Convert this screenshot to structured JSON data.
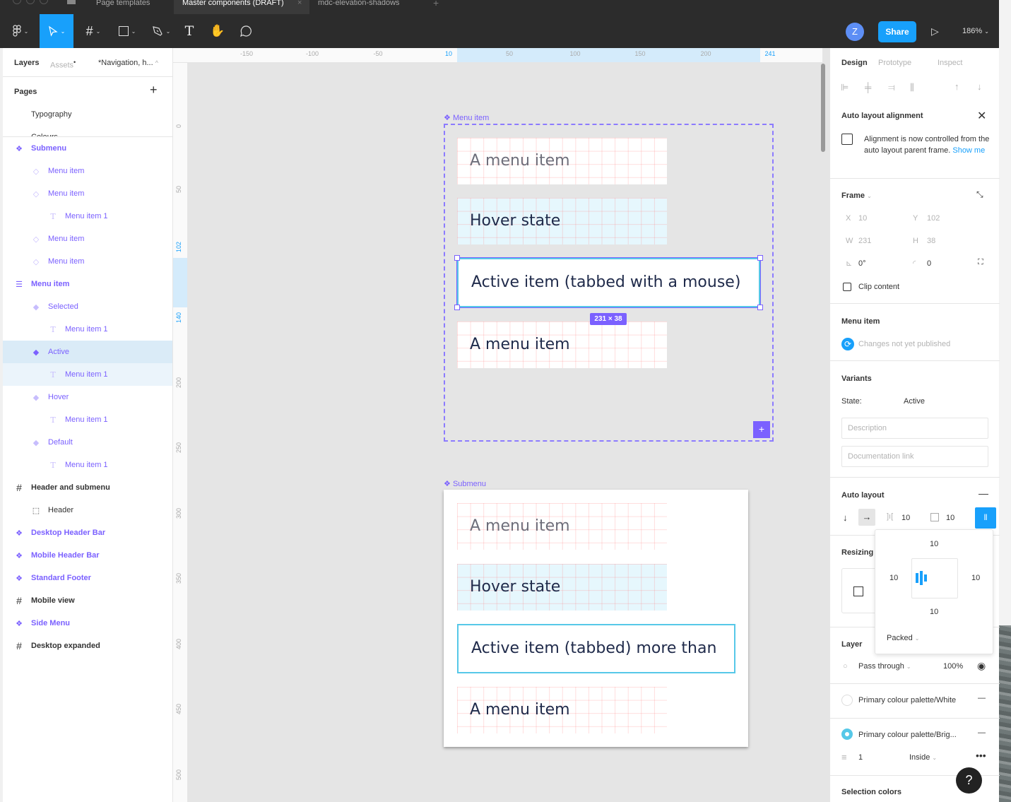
{
  "tabs": [
    {
      "label": "Page templates",
      "active": false
    },
    {
      "label": "Master components (DRAFT)",
      "active": true
    },
    {
      "label": "mdc-elevation-shadows",
      "active": false
    }
  ],
  "toolbar": {
    "tools": [
      "figma-menu",
      "move",
      "frame",
      "shape",
      "pen",
      "text",
      "hand",
      "comment"
    ],
    "avatar_initial": "Z",
    "share_label": "Share",
    "zoom_level": "186%"
  },
  "left_panel": {
    "tabs": {
      "layers": "Layers",
      "assets": "Assets",
      "page_selector": "*Navigation, h..."
    },
    "pages_title": "Pages",
    "pages": [
      "Typography",
      "Colours"
    ],
    "layers": [
      {
        "label": "Submenu",
        "icon": "component-icon",
        "depth": 0,
        "style": "component"
      },
      {
        "label": "Menu item",
        "icon": "instance-icon",
        "depth": 1,
        "style": "instance"
      },
      {
        "label": "Menu item",
        "icon": "instance-icon",
        "depth": 1,
        "style": "instance"
      },
      {
        "label": "Menu item 1",
        "icon": "text-icon",
        "depth": 2,
        "style": "instance"
      },
      {
        "label": "Menu item",
        "icon": "instance-icon",
        "depth": 1,
        "style": "instance"
      },
      {
        "label": "Menu item",
        "icon": "instance-icon",
        "depth": 1,
        "style": "instance"
      },
      {
        "label": "Menu item",
        "icon": "variant-set-icon",
        "depth": 0,
        "style": "component"
      },
      {
        "label": "Selected",
        "icon": "variant-icon",
        "depth": 1,
        "style": "instance"
      },
      {
        "label": "Menu item 1",
        "icon": "text-icon",
        "depth": 2,
        "style": "instance"
      },
      {
        "label": "Active",
        "icon": "variant-icon",
        "depth": 1,
        "style": "instance",
        "selected": true
      },
      {
        "label": "Menu item 1",
        "icon": "text-icon",
        "depth": 2,
        "style": "instance",
        "child_selected": true
      },
      {
        "label": "Hover",
        "icon": "variant-icon",
        "depth": 1,
        "style": "instance"
      },
      {
        "label": "Menu item 1",
        "icon": "text-icon",
        "depth": 2,
        "style": "instance"
      },
      {
        "label": "Default",
        "icon": "variant-icon",
        "depth": 1,
        "style": "instance"
      },
      {
        "label": "Menu item 1",
        "icon": "text-icon",
        "depth": 2,
        "style": "instance"
      },
      {
        "label": "Header and submenu",
        "icon": "frame-icon",
        "depth": 0,
        "style": "frame"
      },
      {
        "label": "Header",
        "icon": "group-icon",
        "depth": 1,
        "style": "plain"
      },
      {
        "label": "Desktop Header Bar",
        "icon": "component-icon",
        "depth": 0,
        "style": "component"
      },
      {
        "label": "Mobile Header Bar",
        "icon": "component-icon",
        "depth": 0,
        "style": "component"
      },
      {
        "label": "Standard Footer",
        "icon": "component-icon",
        "depth": 0,
        "style": "component"
      },
      {
        "label": "Mobile view",
        "icon": "frame-icon",
        "depth": 0,
        "style": "frame"
      },
      {
        "label": "Side Menu",
        "icon": "component-icon",
        "depth": 0,
        "style": "component"
      },
      {
        "label": "Desktop expanded",
        "icon": "frame-icon",
        "depth": 0,
        "style": "frame"
      }
    ]
  },
  "rulers": {
    "horizontal": [
      "-150",
      "-100",
      "-50",
      "10",
      "50",
      "100",
      "150",
      "200",
      "241"
    ],
    "vertical": [
      "0",
      "50",
      "102",
      "140",
      "200",
      "250",
      "300",
      "350",
      "400",
      "450",
      "500"
    ],
    "highlight_h": [
      "10",
      "241"
    ],
    "highlight_v": [
      "102",
      "140"
    ]
  },
  "canvas": {
    "frame1": {
      "label": "Menu item",
      "items": [
        {
          "text": "A menu item",
          "state": "default-grey"
        },
        {
          "text": "Hover state",
          "state": "hover"
        },
        {
          "text": "Active item (tabbed with a mouse)",
          "state": "active"
        },
        {
          "text": "A menu item",
          "state": "default"
        }
      ],
      "size_badge": "231 × 38"
    },
    "frame2": {
      "label": "Submenu",
      "items": [
        {
          "text": "A menu item",
          "state": "default-grey"
        },
        {
          "text": "Hover state",
          "state": "hover"
        },
        {
          "text": "Active item (tabbed) more than",
          "state": "active"
        },
        {
          "text": "A menu item",
          "state": "default"
        }
      ]
    },
    "colors": {
      "selection": "#7b61ff",
      "active_border": "#56c8e8",
      "hover_bg": "#e6f7fd",
      "text": "#1f2a4a"
    }
  },
  "right_panel": {
    "tabs": [
      "Design",
      "Prototype",
      "Inspect"
    ],
    "auto_layout_alignment": {
      "title": "Auto layout alignment",
      "message": "Alignment is now controlled from the auto layout parent frame.",
      "link": "Show me"
    },
    "frame": {
      "title": "Frame",
      "x": "10",
      "y": "102",
      "w": "231",
      "h": "38",
      "rotation": "0°",
      "radius": "0",
      "clip_content": "Clip content",
      "labels": {
        "x": "X",
        "y": "Y",
        "w": "W",
        "h": "H"
      }
    },
    "component": {
      "title": "Menu item",
      "status": "Changes not yet published"
    },
    "variants": {
      "title": "Variants",
      "property": "State:",
      "value": "Active",
      "description_placeholder": "Description",
      "doc_link_placeholder": "Documentation link"
    },
    "auto_layout": {
      "title": "Auto layout",
      "spacing": "10",
      "padding": "10"
    },
    "padding_popover": {
      "top": "10",
      "left": "10",
      "right": "10",
      "bottom": "10",
      "distribution": "Packed"
    },
    "resizing": {
      "title": "Resizing"
    },
    "layer": {
      "title": "Layer",
      "blend": "Pass through",
      "opacity": "100%"
    },
    "fills": [
      {
        "name": "Primary colour palette/White",
        "color": "#ffffff"
      },
      {
        "name": "Primary colour palette/Brig...",
        "color": "#56c8e8"
      }
    ],
    "stroke": {
      "weight": "1",
      "position": "Inside"
    },
    "selection_colors_title": "Selection colors",
    "help": "?"
  }
}
